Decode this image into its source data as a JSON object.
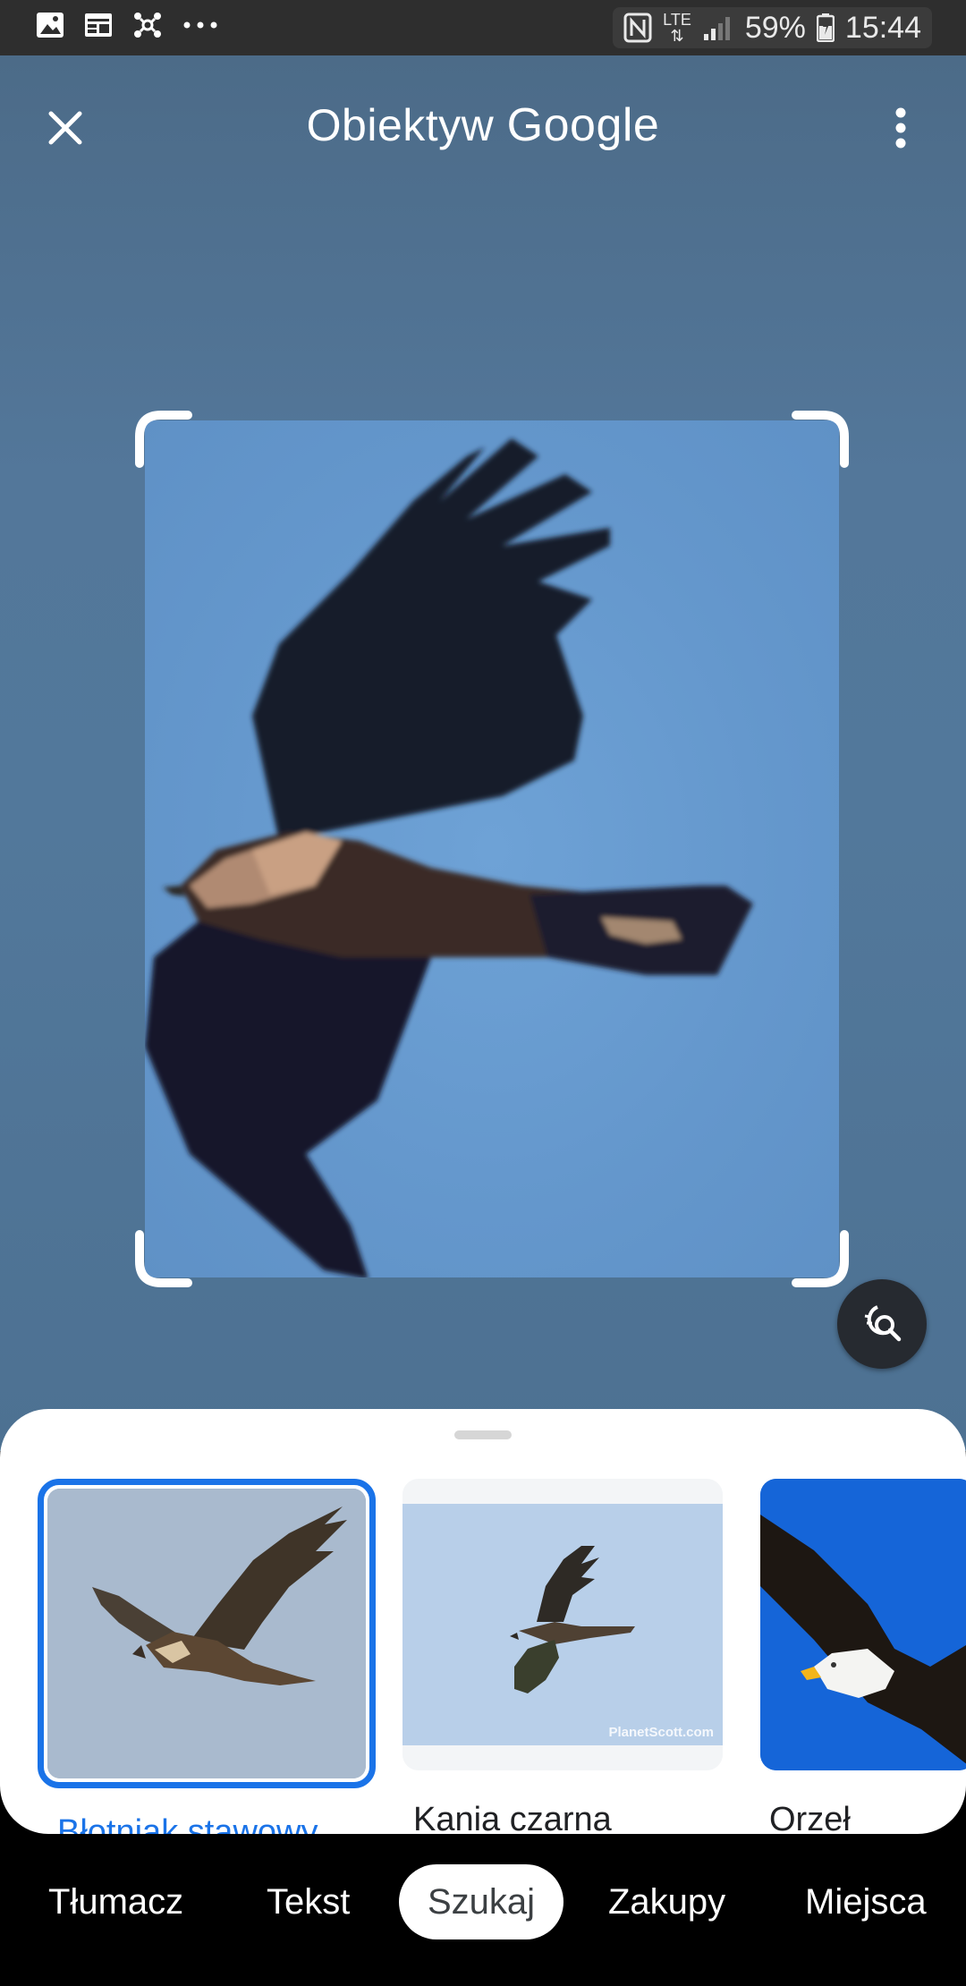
{
  "status_bar": {
    "icons_left": [
      "image-icon",
      "calendar-icon",
      "nodes-icon",
      "more-dots-icon"
    ],
    "nfc": "N",
    "network": "LTE",
    "battery": "59%",
    "time": "15:44"
  },
  "header": {
    "title_prefix": "Obiektyw",
    "title_brand": "Google"
  },
  "results": [
    {
      "label": "Błotniak stawowy",
      "selected": true
    },
    {
      "label": "Kania czarna",
      "selected": false,
      "watermark": "PlanetScott.com"
    },
    {
      "label": "Orzeł",
      "selected": false
    }
  ],
  "modes": [
    "Tłumacz",
    "Tekst",
    "Szukaj",
    "Zakupy",
    "Miejsca"
  ],
  "active_mode": "Szukaj",
  "colors": {
    "accent": "#1a73e8",
    "sky": "#6497cc",
    "status_bar": "#2e2e2e"
  }
}
